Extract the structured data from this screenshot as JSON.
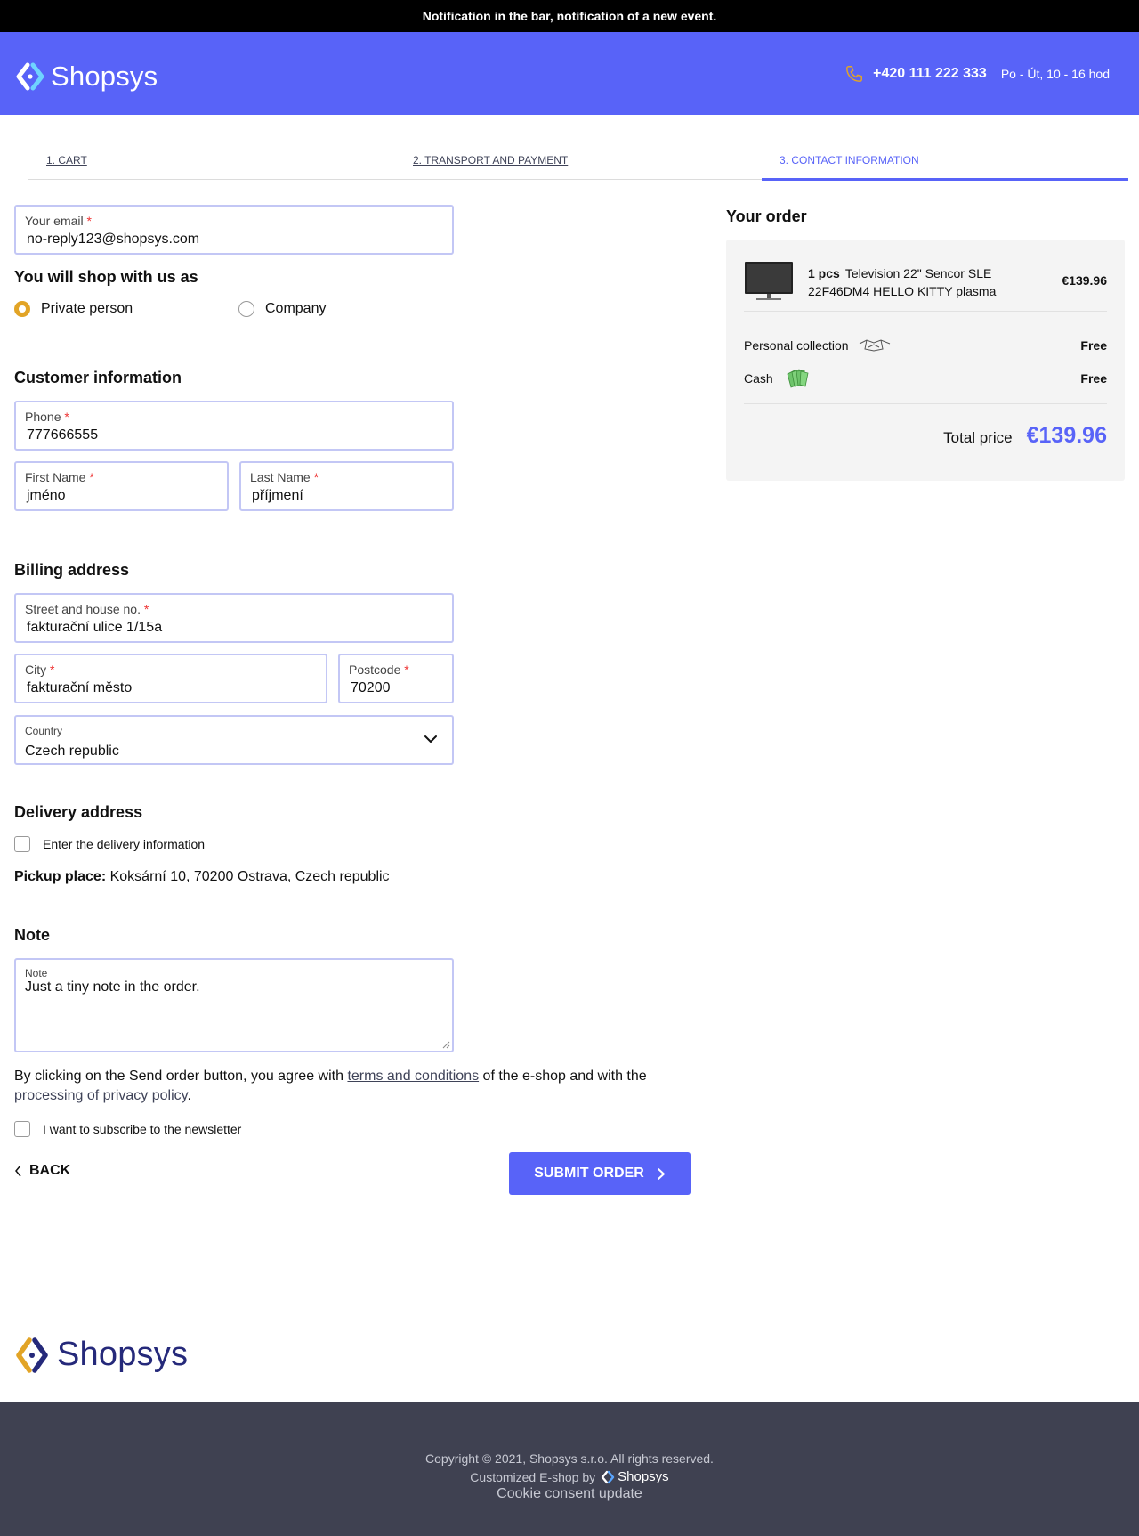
{
  "notification": "Notification in the bar, notification of a new event.",
  "header": {
    "logo_text": "Shopsys",
    "phone": "+420 111 222 333",
    "hours": "Po - Út, 10 - 16 hod"
  },
  "steps": [
    {
      "label": "1. CART"
    },
    {
      "label": "2. TRANSPORT AND PAYMENT"
    },
    {
      "label": "3. CONTACT INFORMATION"
    }
  ],
  "form": {
    "email": {
      "label": "Your email",
      "value": "no-reply123@shopsys.com"
    },
    "shop_as_title": "You will shop with us as",
    "shop_as_options": [
      {
        "label": "Private person",
        "selected": true
      },
      {
        "label": "Company",
        "selected": false
      }
    ],
    "customer_title": "Customer information",
    "phone": {
      "label": "Phone",
      "value": "777666555"
    },
    "first_name": {
      "label": "First Name",
      "value": "jméno"
    },
    "last_name": {
      "label": "Last Name",
      "value": "příjmení"
    },
    "billing_title": "Billing address",
    "street": {
      "label": "Street and house no.",
      "value": "fakturační ulice 1/15a"
    },
    "city": {
      "label": "City",
      "value": "fakturační město"
    },
    "postcode": {
      "label": "Postcode",
      "value": "70200"
    },
    "country": {
      "label": "Country",
      "value": "Czech republic"
    },
    "delivery_title": "Delivery address",
    "delivery_checkbox": "Enter the delivery information",
    "pickup_label": "Pickup place:",
    "pickup_value": "Koksární 10, 70200 Ostrava, Czech republic",
    "note_title": "Note",
    "note": {
      "label": "Note",
      "value": "Just a tiny note in the order."
    },
    "legal_prefix": "By clicking on the Send order button, you agree with ",
    "legal_terms": "terms and conditions",
    "legal_middle": " of the e-shop and with the ",
    "legal_privacy": "processing of privacy policy",
    "legal_suffix": ".",
    "newsletter": "I want to subscribe to the newsletter",
    "required_mark": "*"
  },
  "actions": {
    "back": "BACK",
    "submit": "SUBMIT ORDER"
  },
  "order": {
    "title": "Your order",
    "item_qty": "1 pcs",
    "item_name": "Television 22\" Sencor SLE 22F46DM4 HELLO KITTY plasma",
    "item_price": "€139.96",
    "transport_label": "Personal collection",
    "transport_price": "Free",
    "payment_label": "Cash",
    "payment_price": "Free",
    "total_label": "Total price",
    "total_value": "€139.96"
  },
  "footer": {
    "logo_text": "Shopsys",
    "copyright": "Copyright © 2021, Shopsys s.r.o. All rights reserved.",
    "customized": "Customized E-shop by",
    "mini_logo_text": "Shopsys",
    "cookie": "Cookie consent update"
  },
  "colors": {
    "brand_blue": "#5863f8",
    "accent_orange": "#e2a426",
    "footer_bg": "#3f4151",
    "footer_logo": "#25297a"
  }
}
